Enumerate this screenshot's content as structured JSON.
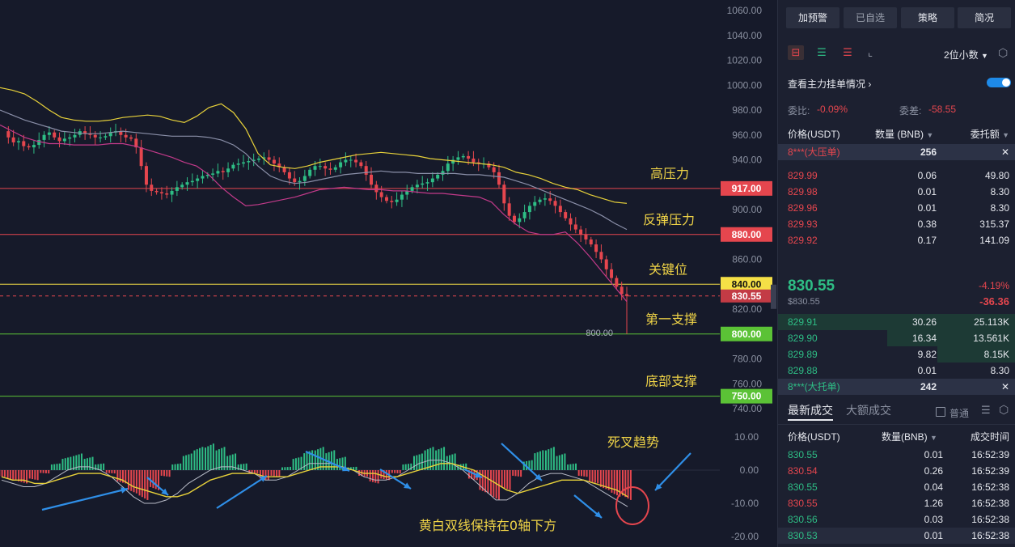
{
  "chart_data": {
    "type": "candlestick",
    "symbol_pair": "BNB/USDT",
    "price_axis": {
      "ticks": [
        "1060.00",
        "1040.00",
        "1020.00",
        "1000.00",
        "980.00",
        "960.00",
        "940.00",
        "920.00",
        "900.00",
        "880.00",
        "860.00",
        "840.00",
        "820.00",
        "800.00",
        "780.00",
        "760.00",
        "740.00"
      ],
      "range": [
        740,
        1060
      ]
    },
    "macd_axis": {
      "ticks": [
        "10.00",
        "0.00",
        "-10.00",
        "-20.00"
      ],
      "range": [
        -20,
        10
      ]
    },
    "close_series": [
      963,
      958,
      954,
      955,
      951,
      950,
      952,
      956,
      960,
      962,
      958,
      955,
      957,
      958,
      960,
      963,
      961,
      960,
      958,
      958,
      959,
      962,
      963,
      960,
      958,
      957,
      950,
      935,
      920,
      915,
      914,
      913,
      912,
      915,
      918,
      920,
      922,
      923,
      925,
      927,
      928,
      929,
      931,
      930,
      933,
      936,
      937,
      938,
      939,
      940,
      941,
      942,
      940,
      937,
      934,
      930,
      925,
      922,
      923,
      927,
      932,
      935,
      935,
      933,
      932,
      934,
      938,
      940,
      940,
      938,
      935,
      928,
      920,
      914,
      910,
      907,
      906,
      908,
      912,
      915,
      918,
      920,
      921,
      922,
      925,
      928,
      931,
      937,
      940,
      942,
      943,
      941,
      938,
      937,
      937,
      934,
      930,
      920,
      905,
      895,
      890,
      893,
      898,
      903,
      906,
      908,
      909,
      907,
      903,
      898,
      893,
      888,
      884,
      880,
      876,
      872,
      866,
      860,
      852,
      845,
      838,
      832,
      830.55
    ],
    "bollinger_upper": [
      998,
      996,
      993,
      987,
      980,
      974,
      972,
      971,
      971,
      972,
      974,
      975,
      976,
      975,
      972,
      970,
      975,
      982,
      985,
      978,
      965,
      945,
      936,
      934,
      933,
      935,
      938,
      940,
      942,
      944,
      945,
      946,
      945,
      944,
      943,
      941,
      940,
      939,
      938,
      937,
      936,
      934,
      930,
      928,
      925,
      921,
      918,
      916,
      912,
      909,
      906,
      905
    ],
    "bollinger_mid": [
      980,
      976,
      972,
      969,
      966,
      963,
      962,
      961,
      961,
      962,
      963,
      962,
      961,
      960,
      959,
      959,
      959,
      958,
      956,
      952,
      945,
      935,
      927,
      923,
      921,
      922,
      924,
      926,
      928,
      929,
      930,
      931,
      930,
      930,
      929,
      929,
      929,
      929,
      928,
      928,
      927,
      926,
      923,
      920,
      916,
      912,
      908,
      904,
      900,
      895,
      889,
      884
    ],
    "bollinger_lower": [
      968,
      963,
      958,
      955,
      953,
      953,
      952,
      952,
      952,
      953,
      953,
      951,
      948,
      945,
      942,
      938,
      935,
      928,
      918,
      910,
      903,
      904,
      906,
      908,
      910,
      913,
      916,
      917,
      918,
      917,
      916,
      916,
      915,
      915,
      914,
      913,
      913,
      912,
      911,
      910,
      906,
      896,
      888,
      882,
      880,
      880,
      882,
      873,
      862,
      850,
      838,
      826
    ],
    "macd_hist": [
      -2,
      -3,
      -4,
      -3,
      -1,
      2,
      4,
      5,
      4,
      2,
      -1,
      -4,
      -7,
      -9,
      -6,
      -2,
      2,
      5,
      7,
      8,
      7,
      5,
      2,
      -1,
      -3,
      -2,
      1,
      4,
      6,
      7,
      6,
      4,
      1,
      -2,
      -4,
      -3,
      -1,
      2,
      5,
      7,
      7,
      5,
      2,
      -3,
      -7,
      -9,
      -6,
      -2,
      3,
      6,
      7,
      5,
      2,
      -2,
      -4,
      -6,
      -8,
      -9
    ],
    "macd_dif": [
      -3,
      -4,
      -5,
      -5,
      -4,
      -2,
      0,
      1,
      1,
      0,
      -2,
      -5,
      -8,
      -10,
      -10,
      -9,
      -7,
      -4,
      -2,
      0,
      1,
      1,
      0,
      -1,
      -3,
      -3,
      -2,
      0,
      2,
      2,
      2,
      1,
      0,
      -2,
      -3,
      -3,
      -2,
      0,
      2,
      3,
      3,
      2,
      0,
      -3,
      -6,
      -9,
      -9,
      -7,
      -4,
      -2,
      -1,
      -1,
      -2,
      -3,
      -5,
      -7,
      -9,
      -11
    ],
    "macd_dea": [
      -2,
      -3,
      -3,
      -4,
      -4,
      -3,
      -2,
      -1,
      -1,
      -1,
      -2,
      -3,
      -5,
      -6,
      -7,
      -8,
      -8,
      -7,
      -5,
      -3,
      -2,
      -1,
      -1,
      -1,
      -2,
      -2,
      -2,
      -1,
      0,
      1,
      1,
      1,
      0,
      -1,
      -1,
      -2,
      -2,
      -1,
      0,
      1,
      2,
      2,
      1,
      0,
      -2,
      -4,
      -6,
      -7,
      -6,
      -5,
      -4,
      -3,
      -3,
      -3,
      -4,
      -5,
      -6,
      -8
    ],
    "levels": [
      {
        "price": 917.0,
        "tag": "917.00",
        "name": "高压力",
        "line_color": "#e5464e",
        "tag_color": "#e5464e"
      },
      {
        "price": 880.0,
        "tag": "880.00",
        "name": "反弹压力",
        "line_color": "#e5464e",
        "tag_color": "#e5464e"
      },
      {
        "price": 840.0,
        "tag": "840.00",
        "name": "关键位",
        "line_color": "#f5e046",
        "tag_color": "#f5e046"
      },
      {
        "price": 800.0,
        "tag": "800.00",
        "name": "第一支撑",
        "line_color": "#5bc236",
        "tag_color": "#5bc236"
      },
      {
        "price": 750.0,
        "tag": "750.00",
        "name": "底部支撑",
        "line_color": "#5bc236",
        "tag_color": "#5bc236"
      }
    ],
    "current_price_tag": "830.55",
    "low_label": "800.00",
    "annotations": {
      "macd_cross": "死叉趋势",
      "macd_note": "黄白双线保持在0轴下方"
    }
  },
  "sidebar": {
    "top_buttons": [
      "加预警",
      "已自选",
      "策略",
      "简况"
    ],
    "decimal_select": "2位小数",
    "main_orders_label": "查看主力挂单情况",
    "ratio_label": "委比:",
    "ratio_value": "-0.09%",
    "diff_label": "委差:",
    "diff_value": "-58.55",
    "book_headers": {
      "price": "价格(USDT)",
      "qty": "数量 (BNB)",
      "total": "委托额"
    },
    "big_ask": {
      "label": "8***(大压单)",
      "qty": "256"
    },
    "asks": [
      {
        "price": "829.99",
        "qty": "0.06",
        "total": "49.80"
      },
      {
        "price": "829.98",
        "qty": "0.01",
        "total": "8.30"
      },
      {
        "price": "829.96",
        "qty": "0.01",
        "total": "8.30"
      },
      {
        "price": "829.93",
        "qty": "0.38",
        "total": "315.37"
      },
      {
        "price": "829.92",
        "qty": "0.17",
        "total": "141.09"
      }
    ],
    "last_price": "830.55",
    "last_price_usd": "$830.55",
    "change_pct": "-4.19%",
    "change_abs": "-36.36",
    "bids": [
      {
        "price": "829.91",
        "qty": "30.26",
        "total": "25.113K",
        "depth": 1.0
      },
      {
        "price": "829.90",
        "qty": "16.34",
        "total": "13.561K",
        "depth": 0.54
      },
      {
        "price": "829.89",
        "qty": "9.82",
        "total": "8.15K",
        "depth": 0.33
      },
      {
        "price": "829.88",
        "qty": "0.01",
        "total": "8.30",
        "depth": 0.0
      },
      {
        "price": "829.87",
        "qty": "0.03",
        "total": "24.90",
        "depth": 0.0
      }
    ],
    "big_bid": {
      "label": "8***(大托单)",
      "qty": "242"
    },
    "trade_tabs": [
      "最新成交",
      "大额成交"
    ],
    "normal_label": "普通",
    "trade_headers": {
      "price": "价格(USDT)",
      "qty": "数量(BNB)",
      "time": "成交时间"
    },
    "trades": [
      {
        "price": "830.55",
        "qty": "0.01",
        "time": "16:52:39",
        "side": "buy"
      },
      {
        "price": "830.54",
        "qty": "0.26",
        "time": "16:52:39",
        "side": "sell"
      },
      {
        "price": "830.55",
        "qty": "0.04",
        "time": "16:52:38",
        "side": "buy"
      },
      {
        "price": "830.55",
        "qty": "1.26",
        "time": "16:52:38",
        "side": "sell"
      },
      {
        "price": "830.56",
        "qty": "0.03",
        "time": "16:52:38",
        "side": "buy"
      },
      {
        "price": "830.53",
        "qty": "0.01",
        "time": "16:52:38",
        "side": "buy"
      }
    ]
  }
}
